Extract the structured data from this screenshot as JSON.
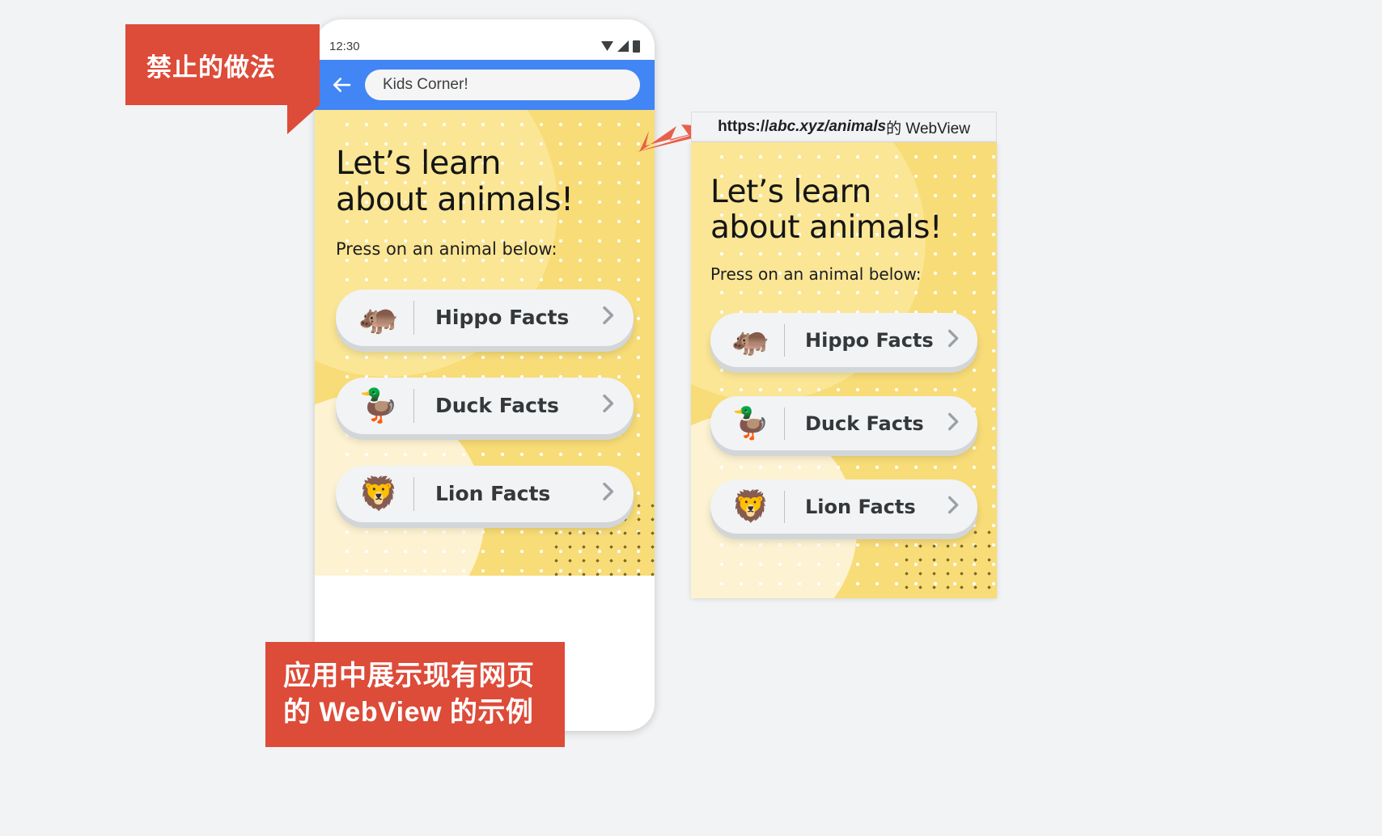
{
  "callouts": {
    "top": "禁止的做法",
    "bottom_line1": "应用中展示现有网页",
    "bottom_line2": "的 WebView 的示例"
  },
  "phone": {
    "status": {
      "time": "12:30",
      "icons": [
        "wifi-icon",
        "cell-signal-icon",
        "battery-icon"
      ]
    },
    "appbar": {
      "back_icon": "back-arrow-icon",
      "url_value": "Kids Corner!"
    }
  },
  "webview_card": {
    "label_protocol": "https://",
    "label_url": "abc.xyz/animals",
    "label_suffix": " 的 WebView"
  },
  "kids_page": {
    "heading_line1": "Let’s learn",
    "heading_line2": "about animals!",
    "subtitle": "Press on an animal below:",
    "buttons": [
      {
        "emoji": "🦛",
        "label": "Hippo Facts",
        "chevron": "chevron-right-icon"
      },
      {
        "emoji": "🦆",
        "label": "Duck Facts",
        "chevron": "chevron-right-icon"
      },
      {
        "emoji": "🦁",
        "label": "Lion Facts",
        "chevron": "chevron-right-icon"
      }
    ]
  },
  "colors": {
    "callout_red": "#dd4b39",
    "appbar_blue": "#4285f4",
    "page_yellow": "#f8dc77",
    "button_grey": "#f1f3f4",
    "background": "#f1f3f4"
  }
}
